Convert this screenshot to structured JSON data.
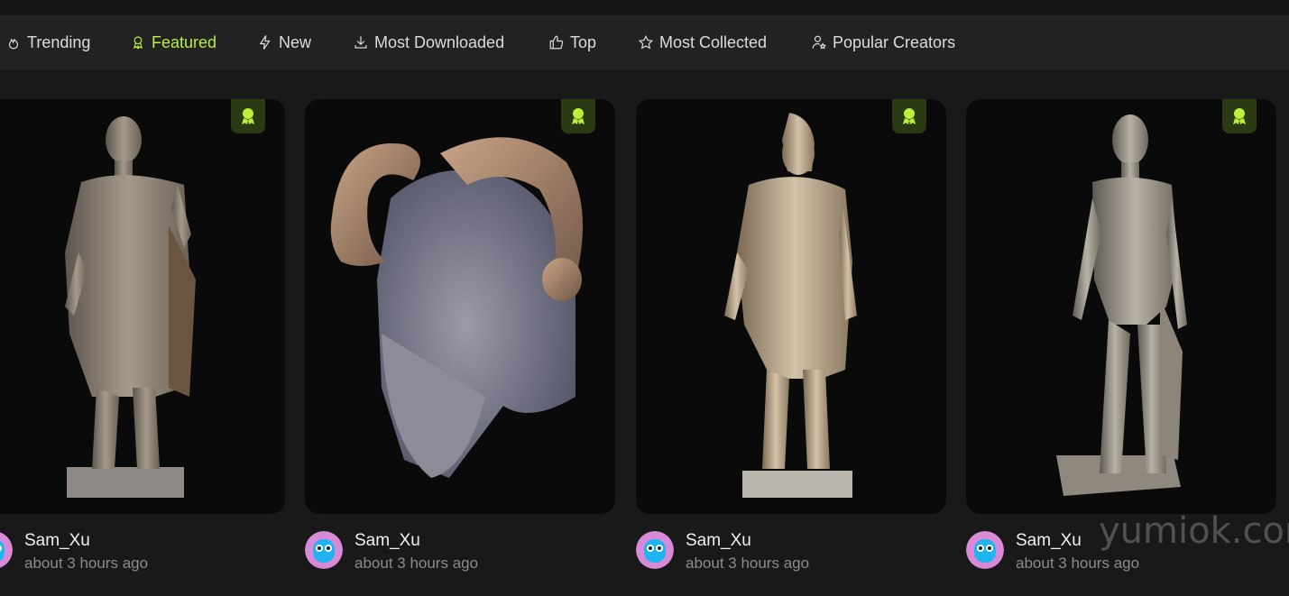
{
  "nav": {
    "items": [
      {
        "label": "Trending",
        "icon": "flame-icon"
      },
      {
        "label": "Featured",
        "icon": "award-icon",
        "active": true
      },
      {
        "label": "New",
        "icon": "lightning-icon"
      },
      {
        "label": "Most Downloaded",
        "icon": "download-icon"
      },
      {
        "label": "Top",
        "icon": "thumbs-up-icon"
      },
      {
        "label": "Most Collected",
        "icon": "star-icon"
      },
      {
        "label": "Popular Creators",
        "icon": "user-star-icon"
      }
    ],
    "active_color": "#b8f03a"
  },
  "cards": [
    {
      "subject": "statue-warrior",
      "badge": "featured-badge-icon",
      "author": "Sam_Xu",
      "time": "about 3 hours ago"
    },
    {
      "subject": "ram-horned-head",
      "badge": "featured-badge-icon",
      "author": "Sam_Xu",
      "time": "about 3 hours ago"
    },
    {
      "subject": "statue-helmeted-soldier",
      "badge": "featured-badge-icon",
      "author": "Sam_Xu",
      "time": "about 3 hours ago"
    },
    {
      "subject": "statue-athlete",
      "badge": "featured-badge-icon",
      "author": "Sam_Xu",
      "time": "about 3 hours ago"
    }
  ],
  "watermark": "yumiok.com"
}
